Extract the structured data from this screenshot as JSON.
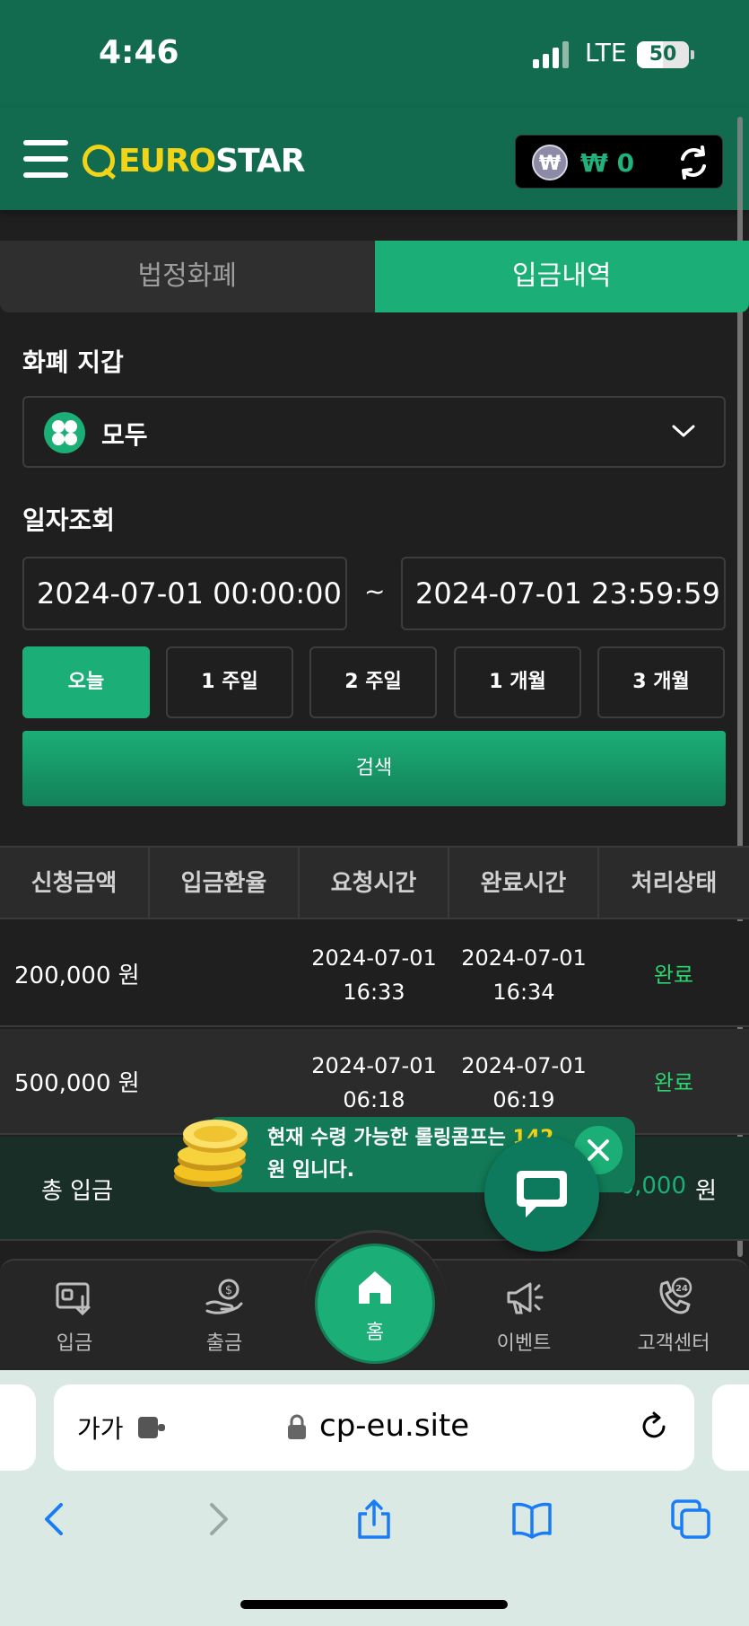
{
  "status_bar": {
    "time": "4:46",
    "network": "LTE",
    "battery": "50",
    "battery_level": 0.5
  },
  "header": {
    "logo_euro": "EURO",
    "logo_star": "STAR",
    "balance": "₩ 0",
    "currency_symbol": "₩"
  },
  "tabs": [
    {
      "label": "법정화폐",
      "active": false
    },
    {
      "label": "입금내역",
      "active": true
    }
  ],
  "wallet": {
    "label": "화폐 지갑",
    "selected": "모두"
  },
  "date_filter": {
    "label": "일자조회",
    "start": "2024-07-01 00:00:00",
    "end": "2024-07-01 23:59:59",
    "separator": "~",
    "ranges": [
      "오늘",
      "1 주일",
      "2 주일",
      "1 개월",
      "3 개월"
    ],
    "search_label": "검색"
  },
  "table": {
    "headers": [
      "신청금액",
      "입금환율",
      "요청시간",
      "완료시간",
      "처리상태"
    ],
    "rows": [
      {
        "amount": "200,000 원",
        "rate": "",
        "request_date": "2024-07-01",
        "request_time": "16:33",
        "complete_date": "2024-07-01",
        "complete_time": "16:34",
        "status": "완료"
      },
      {
        "amount": "500,000 원",
        "rate": "",
        "request_date": "2024-07-01",
        "request_time": "06:18",
        "complete_date": "2024-07-01",
        "complete_time": "06:19",
        "status": "완료"
      }
    ],
    "total_label": "총 입금",
    "total_value": "0,000",
    "total_unit": "원"
  },
  "toast": {
    "line1": "현재 수령 가능한 롤링콤프는 ",
    "highlight": "142",
    "line2": "원 입니다."
  },
  "bottom_nav": [
    {
      "label": "입금",
      "icon": "deposit-icon"
    },
    {
      "label": "출금",
      "icon": "withdraw-icon"
    },
    {
      "label": "홈",
      "icon": "home-icon"
    },
    {
      "label": "이벤트",
      "icon": "megaphone-icon"
    },
    {
      "label": "고객센터",
      "icon": "support-24-icon"
    }
  ],
  "browser": {
    "text_size_label": "가가",
    "url": "cp-eu.site"
  },
  "colors": {
    "brand_green": "#126b4e",
    "accent": "#1bae76",
    "logo_yellow": "#f1d417",
    "status_done": "#2bd46e"
  }
}
